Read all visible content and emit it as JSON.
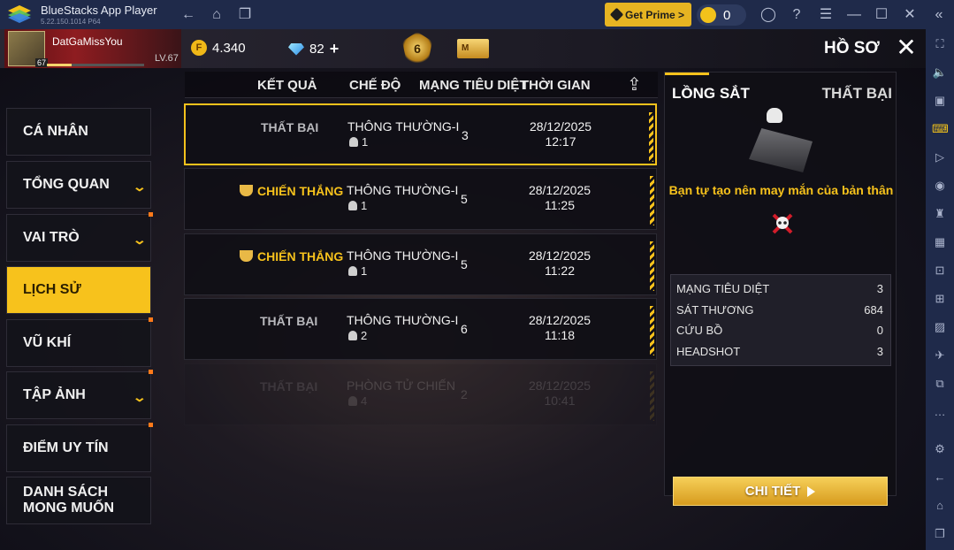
{
  "window": {
    "app_name": "BlueStacks App Player",
    "version": "5.22.150.1014  P64",
    "prime_label": "Get Prime >",
    "coin_balance": "0"
  },
  "topbar": {
    "player_name": "DatGaMissYou",
    "avatar_level": "67",
    "level_label": "LV.67",
    "gold": "4.340",
    "diamonds": "82",
    "diamond_add": "+",
    "rank_number": "6",
    "m_badge": "M",
    "page_title": "HỒ SƠ"
  },
  "menu": [
    {
      "label": "CÁ NHÂN",
      "has_chevron": false
    },
    {
      "label": "TỔNG QUAN",
      "has_chevron": true
    },
    {
      "label": "VAI TRÒ",
      "has_chevron": true
    },
    {
      "label": "LỊCH SỬ",
      "active": true
    },
    {
      "label": "VŨ KHÍ"
    },
    {
      "label": "TẬP ẢNH",
      "has_chevron": true
    },
    {
      "label": "ĐIỂM UY TÍN"
    },
    {
      "label_line1": "DANH SÁCH",
      "label_line2": "MONG MUỐN"
    }
  ],
  "table": {
    "headers": [
      "KẾT QUẢ",
      "CHẾ ĐỘ",
      "MẠNG TIÊU DIỆT",
      "THỜI GIAN"
    ],
    "rows": [
      {
        "result": "THẤT BẠI",
        "mode": "THÔNG THƯỜNG-I",
        "party": "1",
        "kills": "3",
        "date": "28/12/2025",
        "time": "12:17"
      },
      {
        "result": "CHIẾN THẮNG",
        "mode": "THÔNG THƯỜNG-I",
        "party": "1",
        "kills": "5",
        "date": "28/12/2025",
        "time": "11:25"
      },
      {
        "result": "CHIẾN THẮNG",
        "mode": "THÔNG THƯỜNG-I",
        "party": "1",
        "kills": "5",
        "date": "28/12/2025",
        "time": "11:22"
      },
      {
        "result": "THẤT BẠI",
        "mode": "THÔNG THƯỜNG-I",
        "party": "2",
        "kills": "6",
        "date": "28/12/2025",
        "time": "11:18"
      },
      {
        "result": "THẤT BẠI",
        "mode": "PHÒNG TỬ CHIẾN",
        "party": "4",
        "kills": "2",
        "date": "28/12/2025",
        "time": "10:41"
      }
    ]
  },
  "detail": {
    "map_name": "LỒNG SẮT",
    "outcome": "THẤT BẠI",
    "quote": "Bạn tự tạo nên may mắn của bản thân",
    "stats": [
      {
        "label": "MẠNG TIÊU DIỆT",
        "value": "3"
      },
      {
        "label": "SÁT THƯƠNG",
        "value": "684"
      },
      {
        "label": "CỨU BỒ",
        "value": "0"
      },
      {
        "label": "HEADSHOT",
        "value": "3"
      }
    ],
    "detail_button": "CHI TIẾT"
  },
  "colors": {
    "accent": "#f7c21c",
    "titlebar": "#1f2a4a"
  }
}
